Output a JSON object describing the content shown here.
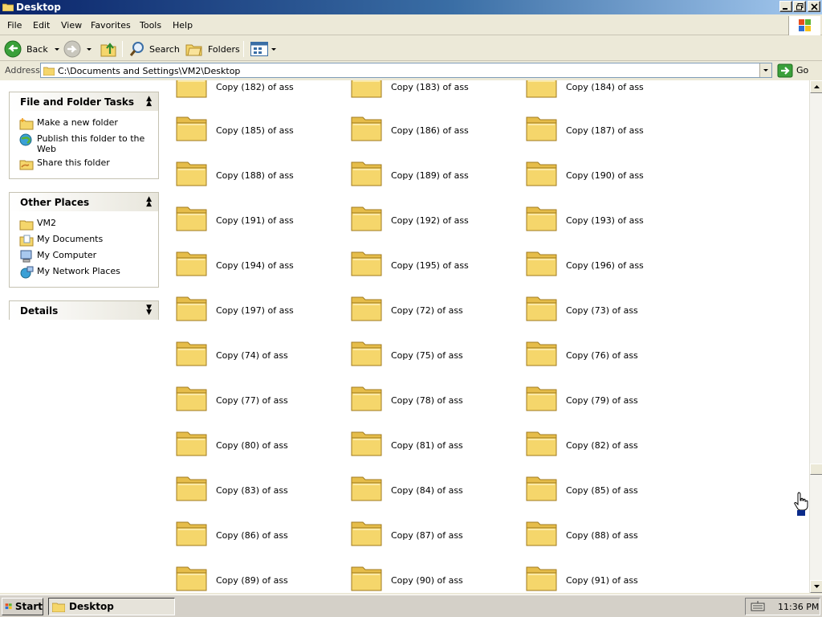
{
  "window": {
    "title": "Desktop"
  },
  "menu": [
    "File",
    "Edit",
    "View",
    "Favorites",
    "Tools",
    "Help"
  ],
  "toolbar": {
    "back": "Back",
    "search": "Search",
    "folders": "Folders"
  },
  "address": {
    "label": "Address",
    "value": "C:\\Documents and Settings\\VM2\\Desktop",
    "go": "Go"
  },
  "left_pane": {
    "tasks": {
      "title": "File and Folder Tasks",
      "items": [
        {
          "label": "Make a new folder",
          "icon": "new-folder-icon"
        },
        {
          "label": "Publish this folder to the Web",
          "icon": "web-publish-icon"
        },
        {
          "label": "Share this folder",
          "icon": "share-folder-icon"
        }
      ]
    },
    "places": {
      "title": "Other Places",
      "items": [
        {
          "label": "VM2",
          "icon": "folder-icon"
        },
        {
          "label": "My Documents",
          "icon": "my-documents-icon"
        },
        {
          "label": "My Computer",
          "icon": "my-computer-icon"
        },
        {
          "label": "My Network Places",
          "icon": "network-places-icon"
        }
      ]
    },
    "details": {
      "title": "Details"
    }
  },
  "folders": {
    "partial_row": [
      "Copy (182) of ass",
      "Copy (183) of ass",
      "Copy (184) of ass"
    ],
    "items": [
      "Copy (185) of ass",
      "Copy (186) of ass",
      "Copy (187) of ass",
      "Copy (188) of ass",
      "Copy (189) of ass",
      "Copy (190) of ass",
      "Copy (191) of ass",
      "Copy (192) of ass",
      "Copy (193) of ass",
      "Copy (194) of ass",
      "Copy (195) of ass",
      "Copy (196) of ass",
      "Copy (197) of ass",
      "Copy (72) of ass",
      "Copy (73) of ass",
      "Copy (74) of ass",
      "Copy (75) of ass",
      "Copy (76) of ass",
      "Copy (77) of ass",
      "Copy (78) of ass",
      "Copy (79) of ass",
      "Copy (80) of ass",
      "Copy (81) of ass",
      "Copy (82) of ass",
      "Copy (83) of ass",
      "Copy (84) of ass",
      "Copy (85) of ass",
      "Copy (86) of ass",
      "Copy (87) of ass",
      "Copy (88) of ass",
      "Copy (89) of ass",
      "Copy (90) of ass",
      "Copy (91) of ass"
    ]
  },
  "taskbar": {
    "start": "Start",
    "window_button": "Desktop",
    "clock": "11:36 PM"
  },
  "colors": {
    "title_bar": "#0a246a",
    "folder": "#f5d66b",
    "panel_header": "#e8e6dc"
  }
}
